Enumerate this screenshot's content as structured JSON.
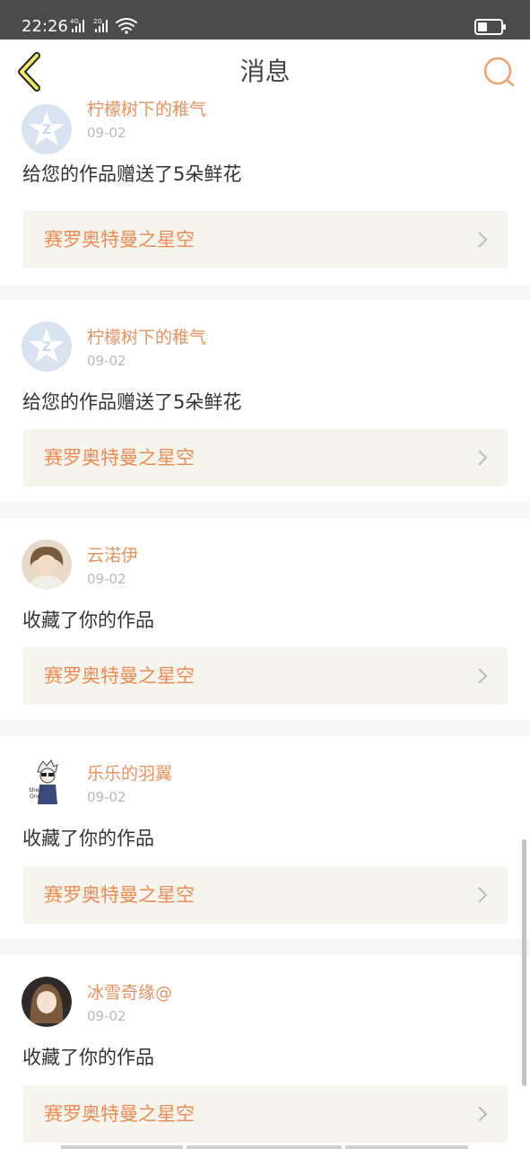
{
  "status_bar": {
    "time": "22:26",
    "net1": "4G",
    "net2": "2G"
  },
  "header": {
    "title": "消息"
  },
  "messages": [
    {
      "user": "柠檬树下的稚气",
      "date": "09-02",
      "text": "给您的作品赠送了5朵鲜花",
      "work": "赛罗奥特曼之星空",
      "avatar": "qzone-default-avatar"
    },
    {
      "user": "柠檬树下的稚气",
      "date": "09-02",
      "text": "给您的作品赠送了5朵鲜花",
      "work": "赛罗奥特曼之星空",
      "avatar": "qzone-default-avatar"
    },
    {
      "user": "云渃伊",
      "date": "09-02",
      "text": "收藏了你的作品",
      "work": "赛罗奥特曼之星空",
      "avatar": "photo-avatar"
    },
    {
      "user": "乐乐的羽翼",
      "date": "09-02",
      "text": "收藏了你的作品",
      "work": "赛罗奥特曼之星空",
      "avatar": "cartoon-avatar"
    },
    {
      "user": "冰雪奇缘@",
      "date": "09-02",
      "text": "收藏了你的作品",
      "work": "赛罗奥特曼之星空",
      "avatar": "photo-avatar"
    }
  ],
  "colors": {
    "accent": "#ec8b55",
    "status_bar": "#4b4b4b",
    "work_bg": "#f5f4ed"
  }
}
